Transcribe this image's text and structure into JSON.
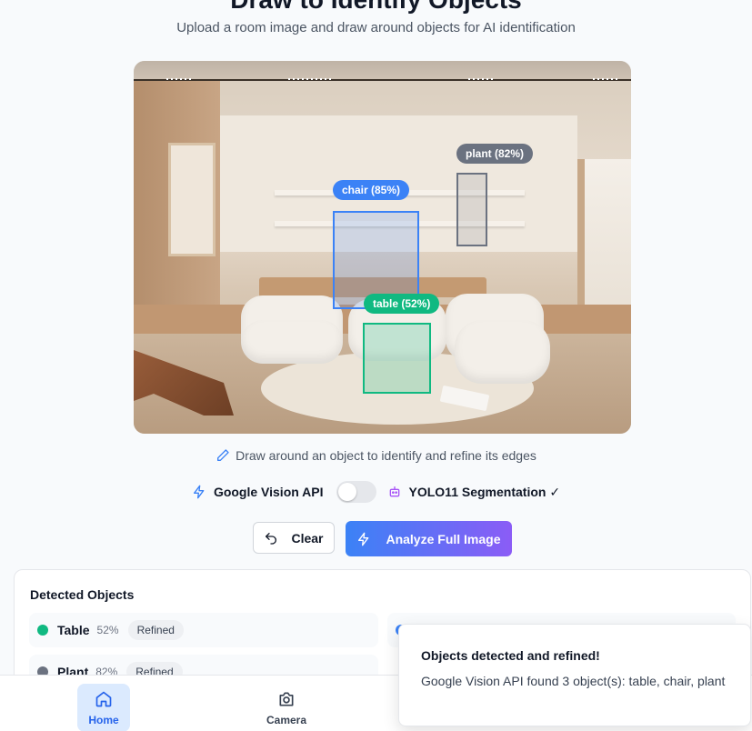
{
  "header": {
    "title": "Draw to Identify Objects",
    "subtitle": "Upload a room image and draw around objects for AI identification"
  },
  "image": {
    "detections": [
      {
        "label": "chair (85%)",
        "color": "#3b82f6"
      },
      {
        "label": "plant (82%)",
        "color": "#6b7280"
      },
      {
        "label": "table (52%)",
        "color": "#10b981"
      }
    ]
  },
  "hint": "Draw around an object to identify and refine its edges",
  "mode": {
    "left_label": "Google Vision API",
    "right_label": "YOLO11 Segmentation ✓",
    "toggle_state": "off"
  },
  "actions": {
    "clear_label": "Clear",
    "analyze_label": "Analyze Full Image"
  },
  "detected": {
    "title": "Detected Objects",
    "items": [
      {
        "name": "Table",
        "confidence": "52%",
        "status": "Refined",
        "color": "#10b981"
      },
      {
        "name": "Plant",
        "confidence": "82%",
        "status": "Refined",
        "color": "#6b7280"
      }
    ]
  },
  "toast": {
    "title": "Objects detected and refined!",
    "body": "Google Vision API found 3 object(s): table, chair, plant"
  },
  "nav": {
    "home_label": "Home",
    "camera_label": "Camera",
    "active": "Home"
  }
}
